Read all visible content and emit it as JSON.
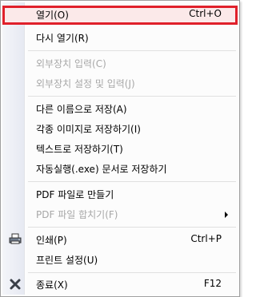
{
  "menu": {
    "items": [
      {
        "label": "열기(O)",
        "shortcut": "Ctrl+O"
      },
      {
        "label": "다시 열기(R)"
      },
      {
        "label": "외부장치 입력(C)"
      },
      {
        "label": "외부장치 설정 및 입력(J)"
      },
      {
        "label": "다른 이름으로 저장(A)"
      },
      {
        "label": "각종 이미지로 저장하기(I)"
      },
      {
        "label": "텍스트로 저장하기(T)"
      },
      {
        "label": "자동실행(.exe) 문서로 저장하기"
      },
      {
        "label": "PDF 파일로 만들기"
      },
      {
        "label": "PDF 파일 합치기(F)"
      },
      {
        "label": "인쇄(P)",
        "shortcut": "Ctrl+P"
      },
      {
        "label": "프린트 설정(U)"
      },
      {
        "label": "종료(X)",
        "shortcut": "F12"
      }
    ]
  },
  "colors": {
    "highlight_border": "#e0202a",
    "disabled_text": "#a7a7a7"
  },
  "icons": {
    "print": "printer-icon",
    "exit": "close-icon"
  }
}
